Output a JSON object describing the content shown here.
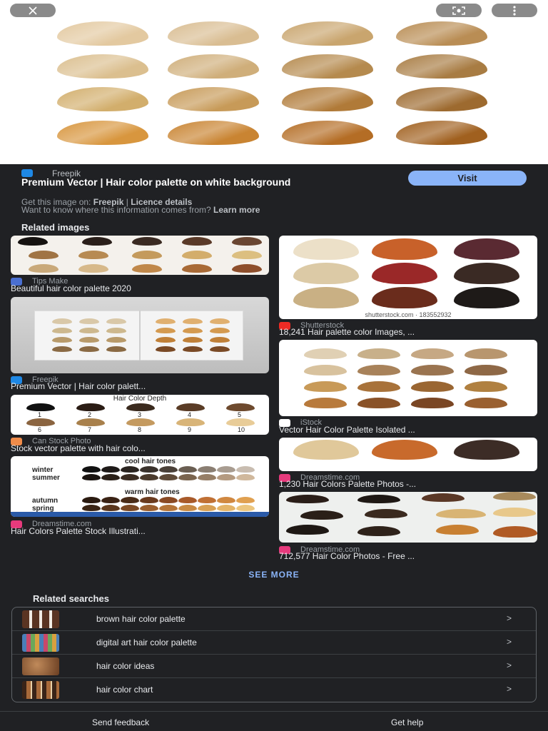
{
  "preview": {
    "close_icon": "close-icon",
    "lens_icon": "lens-icon",
    "more_icon": "more-vert-icon",
    "swatch_colors": [
      [
        "#e3c9a0",
        "#d9bd92",
        "#c9a56e",
        "#b98d54"
      ],
      [
        "#dbbf8f",
        "#cfae7a",
        "#b58a4e",
        "#a87c43"
      ],
      [
        "#d2ae6c",
        "#c79a58",
        "#b07a38",
        "#9d6a2f"
      ],
      [
        "#d8963e",
        "#c98432",
        "#b46d25",
        "#a0601f"
      ]
    ]
  },
  "source": {
    "site": "Freepik",
    "title": "Premium Vector | Hair color palette on white background",
    "visit_label": "Visit",
    "get_image_prefix": "Get this image on:",
    "get_image_site": "Freepik",
    "separator": "|",
    "licence_label": "Licence details",
    "question": "Want to know where this information comes from?",
    "learn_more": "Learn more"
  },
  "related_images": {
    "title": "Related images",
    "cards": [
      {
        "source": "Tips Make",
        "title": "Beautiful hair color palette 2020"
      },
      {
        "source": "Shutterstock",
        "title": "18,241 Hair palette color Images, ...",
        "watermark": "shutterstock.com · 183552932"
      },
      {
        "source": "Freepik",
        "title": "Premium Vector | Hair color palett..."
      },
      {
        "source": "iStock",
        "title": "Vector Hair Color Palette Isolated ..."
      },
      {
        "source": "Can Stock Photo",
        "title": "Stock vector palette with hair colo...",
        "heading": "Hair Color Depth",
        "depths": [
          "1",
          "2",
          "3",
          "4",
          "5",
          "6",
          "7",
          "8",
          "9",
          "10"
        ]
      },
      {
        "source": "Dreamstime.com",
        "title": "1,230 Hair Colors Palette Photos -..."
      },
      {
        "source": "Dreamstime.com",
        "title": "Hair Colors Palette Stock Illustrati...",
        "cool_label": "cool hair tones",
        "warm_label": "warm hair tones",
        "seasons": [
          "winter",
          "summer",
          "autumn",
          "spring"
        ]
      },
      {
        "source": "Dreamstime.com",
        "title": "712,577 Hair Color Photos - Free ..."
      }
    ]
  },
  "see_more": "SEE MORE",
  "related_searches": {
    "title": "Related searches",
    "items": [
      {
        "label": "brown hair color palette",
        "arrow": ">"
      },
      {
        "label": "digital art hair color palette",
        "arrow": ">"
      },
      {
        "label": "hair color ideas",
        "arrow": ">"
      },
      {
        "label": "hair color chart",
        "arrow": ">"
      }
    ]
  },
  "footer": {
    "feedback": "Send feedback",
    "help": "Get help"
  }
}
